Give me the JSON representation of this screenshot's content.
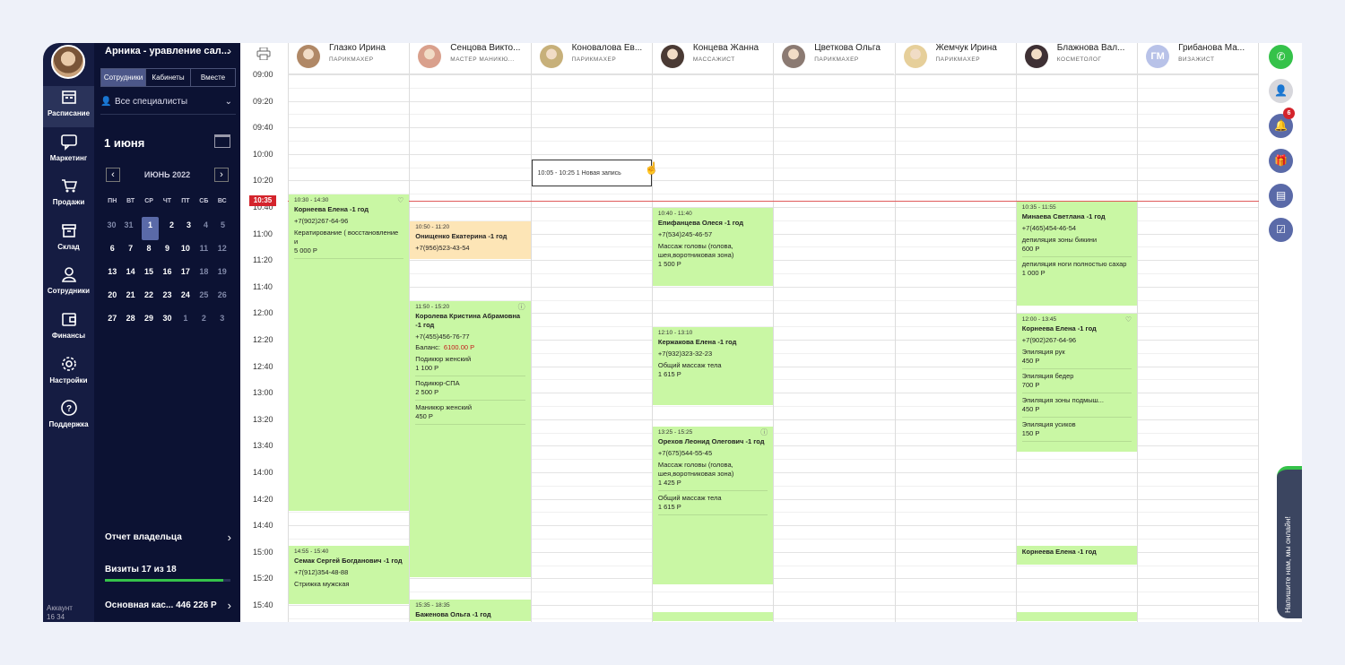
{
  "nav": {
    "items": [
      {
        "label": "Расписание",
        "icon": "calendar-icon"
      },
      {
        "label": "Маркетинг",
        "icon": "chat-icon"
      },
      {
        "label": "Продажи",
        "icon": "cart-icon"
      },
      {
        "label": "Склад",
        "icon": "box-icon"
      },
      {
        "label": "Сотрудники",
        "icon": "user-icon"
      },
      {
        "label": "Финансы",
        "icon": "wallet-icon"
      },
      {
        "label": "Настройки",
        "icon": "gear-icon"
      },
      {
        "label": "Поддержка",
        "icon": "help-icon"
      }
    ],
    "account": "Аккаунт\n16 34"
  },
  "panel": {
    "salon": "Арника - уравление сал...",
    "tabs": [
      "Сотрудники",
      "Кабинеты",
      "Вместе"
    ],
    "specialists": "Все специалисты",
    "date": "1 июня",
    "month": "ИЮНЬ 2022",
    "weekdays": [
      "ПН",
      "ВТ",
      "СР",
      "ЧТ",
      "ПТ",
      "СБ",
      "ВС"
    ],
    "weeks": [
      [
        "30",
        "31",
        "1",
        "2",
        "3",
        "4",
        "5"
      ],
      [
        "6",
        "7",
        "8",
        "9",
        "10",
        "11",
        "12"
      ],
      [
        "13",
        "14",
        "15",
        "16",
        "17",
        "18",
        "19"
      ],
      [
        "20",
        "21",
        "22",
        "23",
        "24",
        "25",
        "26"
      ],
      [
        "27",
        "28",
        "29",
        "30",
        "1",
        "2",
        "3"
      ]
    ],
    "report": "Отчет владельца",
    "visits": "Визиты 17 из 18",
    "visits_progress": 0.944,
    "cash": "Основная кас... 446 226 Р"
  },
  "schedule": {
    "times": [
      "09:00",
      "09:20",
      "09:40",
      "10:00",
      "10:20",
      "10:40",
      "11:00",
      "11:20",
      "11:40",
      "12:00",
      "12:20",
      "12:40",
      "13:00",
      "13:20",
      "13:40",
      "14:00",
      "14:20",
      "14:40",
      "15:00",
      "15:20",
      "15:40"
    ],
    "now": "10:35",
    "staff": [
      {
        "name": "Глазко Ирина",
        "role": "ПАРИКМАХЕР",
        "color": "#b08866"
      },
      {
        "name": "Сенцова Викто...",
        "role": "МАСТЕР МАНИКЮ...",
        "color": "#d9a08c"
      },
      {
        "name": "Коновалова Ев...",
        "role": "ПАРИКМАХЕР",
        "color": "#c7b07a"
      },
      {
        "name": "Концева Жанна",
        "role": "МАССАЖИСТ",
        "color": "#4a3a34"
      },
      {
        "name": "Цветкова Ольга",
        "role": "ПАРИКМАХЕР",
        "color": "#8b7a72"
      },
      {
        "name": "Жемчук Ирина",
        "role": "ПАРИКМАХЕР",
        "color": "#e6cf9a"
      },
      {
        "name": "Блажнова Вал...",
        "role": "КОСМЕТОЛОГ",
        "color": "#3e3034"
      },
      {
        "name": "Грибанова Ма...",
        "role": "ВИЗАЖИСТ",
        "initials": "ГМ",
        "color": "#b8c2e8"
      }
    ],
    "new_record": "10:05 - 10:25    1 Новая запись",
    "appointments": [
      {
        "col": 0,
        "start": "10:30",
        "end": "14:30",
        "time": "10:30 - 14:30",
        "name": "Корнеева Елена -1 год",
        "phone": "+7(902)267-64-96",
        "services": [
          {
            "t": "Кератирование ( восстановление и",
            "p": "5 000 Р"
          }
        ],
        "mark": "♡"
      },
      {
        "col": 0,
        "start": "14:55",
        "end": "15:40",
        "time": "14:55 - 15:40",
        "name": "Семак Сергей Богданович -1 год",
        "phone": "+7(912)354-48-88",
        "services": [
          {
            "t": "Стрижка мужская",
            "p": ""
          }
        ]
      },
      {
        "col": 1,
        "start": "10:50",
        "end": "11:20",
        "time": "10:50 - 11:20",
        "name": "Онищенко Екатерина -1 год",
        "phone": "+7(956)523-43-54",
        "services": [],
        "yellow": true
      },
      {
        "col": 1,
        "start": "11:50",
        "end": "15:20",
        "time": "11:50 - 15:20",
        "name": "Королева Кристина Абрамовна -1 год",
        "phone": "+7(455)456-76-77",
        "balance_label": "Баланс:",
        "balance": "6100.00 Р",
        "services": [
          {
            "t": "Подикюр женский",
            "p": "1 100 Р"
          },
          {
            "t": "Подикюр-СПА",
            "p": "2 500 Р"
          },
          {
            "t": "Маникюр женский",
            "p": "450 Р"
          }
        ],
        "mark": "ⓘ"
      },
      {
        "col": 1,
        "start": "15:35",
        "end": "18:35",
        "time": "15:35 - 18:35",
        "name": "Баженова Ольга -1 год",
        "phone": "",
        "services": []
      },
      {
        "col": 3,
        "start": "10:40",
        "end": "11:40",
        "time": "10:40 - 11:40",
        "name": "Епифанцева Олеся -1 год",
        "phone": "+7(534)245-46-57",
        "services": [
          {
            "t": "Массаж головы (голова, шея,воротниковая зона)",
            "p": "1 500 Р"
          }
        ]
      },
      {
        "col": 3,
        "start": "12:10",
        "end": "13:10",
        "time": "12:10 - 13:10",
        "name": "Кержакова Елена -1 год",
        "phone": "+7(932)323-32-23",
        "services": [
          {
            "t": "Общий массаж тела",
            "p": "1 615 Р"
          }
        ]
      },
      {
        "col": 3,
        "start": "13:25",
        "end": "15:25",
        "time": "13:25 - 15:25",
        "name": "Орехов Леонид Олегович -1 год",
        "phone": "+7(675)544-55-45",
        "services": [
          {
            "t": "Массаж головы (голова, шея,воротниковая зона)",
            "p": "1 425 Р"
          },
          {
            "t": "Общий массаж тела",
            "p": "1 615 Р"
          }
        ],
        "mark": "ⓘ"
      },
      {
        "col": 3,
        "start": "15:45",
        "end": "16:45",
        "time": "",
        "name": "",
        "phone": "",
        "services": []
      },
      {
        "col": 6,
        "start": "10:35",
        "end": "11:55",
        "time": "10:35 - 11:55",
        "name": "Минаева Светлана -1 год",
        "phone": "+7(465)454-46-54",
        "services": [
          {
            "t": "депиляция зоны бикини",
            "p": "600 Р"
          },
          {
            "t": "депиляция ноги полностью сахар",
            "p": "1 000 Р"
          }
        ]
      },
      {
        "col": 6,
        "start": "12:00",
        "end": "13:45",
        "time": "12:00 - 13:45",
        "name": "Корнеева Елена -1 год",
        "phone": "+7(902)267-64-96",
        "services": [
          {
            "t": "Эпиляция рук",
            "p": "450 Р"
          },
          {
            "t": "Эпиляция бедер",
            "p": "700 Р"
          },
          {
            "t": "Эпиляция зоны подмыш...",
            "p": "450 Р"
          },
          {
            "t": "Эпиляция усиков",
            "p": "150 Р"
          }
        ],
        "mark": "♡"
      },
      {
        "col": 6,
        "start": "14:55",
        "end": "15:10",
        "time": "",
        "name": "Корнеева Елена -1 год",
        "phone": "",
        "services": []
      },
      {
        "col": 6,
        "start": "15:45",
        "end": "16:45",
        "time": "",
        "name": "",
        "phone": "",
        "services": []
      }
    ]
  },
  "right_rail": {
    "buttons": [
      "whatsapp-icon",
      "profile-icon",
      "bell-icon",
      "gift-icon",
      "document-icon",
      "checklist-icon"
    ],
    "notifications": "6",
    "chat": "Напишите нам, мы онлайн!"
  },
  "colors": {
    "appointment": "#c9f7a4",
    "appointment_pending": "#fde5b6",
    "now_line": "#d4242c",
    "nav_bg": "#151c42"
  }
}
